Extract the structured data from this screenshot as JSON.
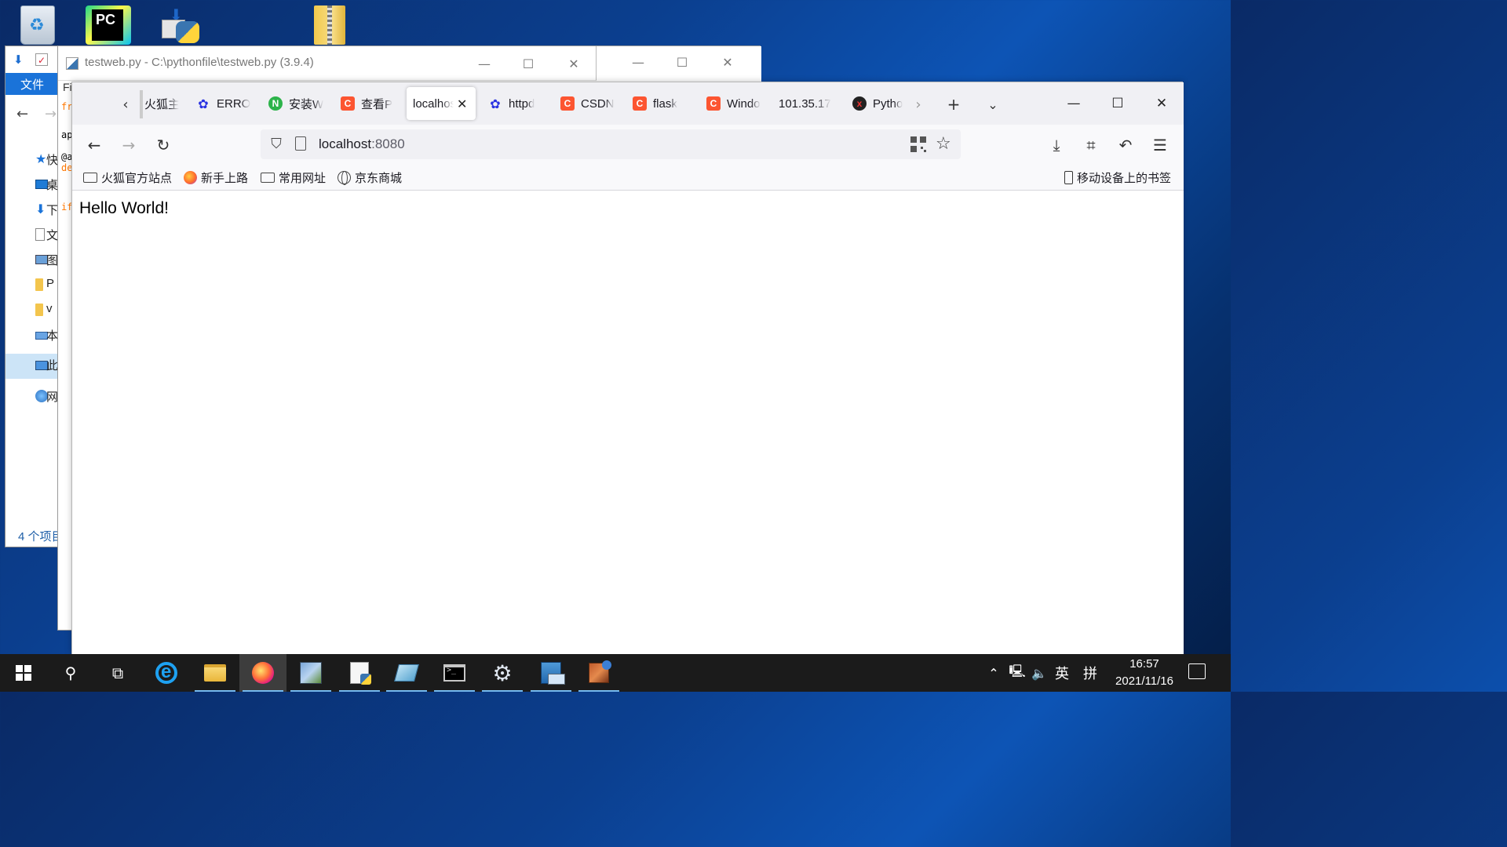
{
  "desktop": {
    "icons": [
      "recycle-bin",
      "pycharm",
      "python-installer",
      "zip-folder"
    ]
  },
  "explorer": {
    "file_tab": "文件",
    "tree": [
      {
        "label": "快",
        "icon": "star-icon"
      },
      {
        "label": "桌",
        "icon": "desktop-icon"
      },
      {
        "label": "下",
        "icon": "download-icon"
      },
      {
        "label": "文",
        "icon": "document-icon"
      },
      {
        "label": "图",
        "icon": "picture-icon"
      },
      {
        "label": "P",
        "icon": "folder-icon"
      },
      {
        "label": "v",
        "icon": "folder-icon"
      },
      {
        "label": "本",
        "icon": "network-drive-icon"
      },
      {
        "label": "此",
        "icon": "pc-icon"
      },
      {
        "label": "网",
        "icon": "network-icon"
      }
    ],
    "status": "4 个项目"
  },
  "idle": {
    "title": "testweb.py - C:\\pythonfile\\testweb.py (3.9.4)",
    "menu_fragment": "Fi",
    "code_fragments": [
      "fr",
      "ap",
      "@a",
      "de",
      "if"
    ]
  },
  "firefox": {
    "tabs": [
      {
        "label": "火狐主",
        "favicon": "none"
      },
      {
        "label": "ERRO",
        "favicon": "baidu-paw-icon"
      },
      {
        "label": "安装W",
        "favicon": "nginx-n-icon"
      },
      {
        "label": "查看P",
        "favicon": "csdn-c-icon"
      },
      {
        "label": "localhost",
        "favicon": "none",
        "active": true
      },
      {
        "label": "httpd",
        "favicon": "baidu-paw-icon"
      },
      {
        "label": "CSDN",
        "favicon": "csdn-c-icon"
      },
      {
        "label": "flask",
        "favicon": "csdn-c-icon"
      },
      {
        "label": "Windo",
        "favicon": "csdn-c-icon"
      },
      {
        "label": "101.35.17",
        "favicon": "none"
      },
      {
        "label": "Pytho",
        "favicon": "python-icon"
      }
    ],
    "url": {
      "host": "localhost",
      "port": ":8080"
    },
    "bookmarks": [
      {
        "label": "火狐官方站点",
        "icon": "folder-icon"
      },
      {
        "label": "新手上路",
        "icon": "firefox-icon"
      },
      {
        "label": "常用网址",
        "icon": "folder-icon"
      },
      {
        "label": "京东商城",
        "icon": "globe-icon"
      }
    ],
    "mobile_bookmarks": "移动设备上的书签",
    "page_text": "Hello World!"
  },
  "taskbar": {
    "ime": "英",
    "ime_mode": "拼",
    "time": "16:57",
    "date": "2021/11/16",
    "accent": "#76b9ed"
  }
}
